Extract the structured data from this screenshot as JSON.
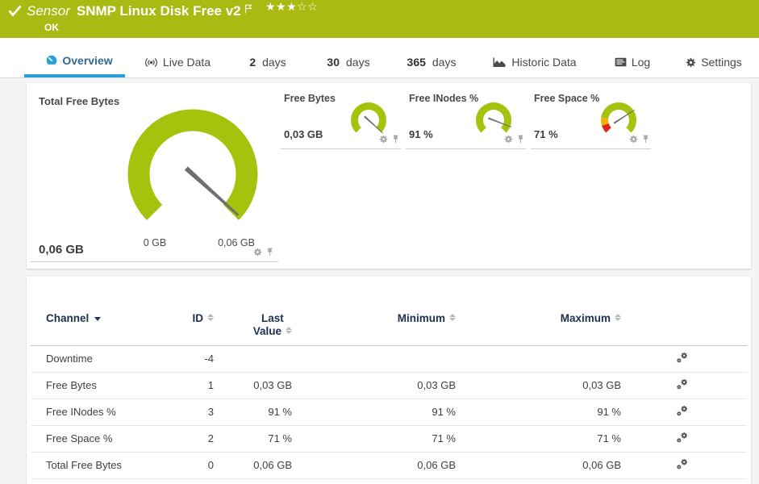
{
  "header": {
    "type_label": "Sensor",
    "title": "SNMP Linux Disk Free v2",
    "status": "OK",
    "stars": "★★★☆☆",
    "bg_color": "#a9ba12"
  },
  "tabs": [
    {
      "label": "Overview",
      "icon": "gauge",
      "active": true
    },
    {
      "label": "Live Data",
      "icon": "live-waves"
    },
    {
      "num": "2",
      "unit": "days"
    },
    {
      "num": "30",
      "unit": "days"
    },
    {
      "num": "365",
      "unit": "days"
    },
    {
      "label": "Historic Data",
      "icon": "area-chart"
    },
    {
      "label": "Log",
      "icon": "log-list"
    },
    {
      "label": "Settings",
      "icon": "gear"
    }
  ],
  "gauges": {
    "accent_green": "#a5c30d",
    "warn_orange": "#f2b600",
    "error_red": "#dc261d",
    "big": {
      "label": "Total Free Bytes",
      "value": "0,06 GB",
      "scale_min": "0 GB",
      "scale_max": "0,06 GB"
    },
    "small": [
      {
        "label": "Free Bytes",
        "value": "0,03 GB"
      },
      {
        "label": "Free INodes %",
        "value": "91 %"
      },
      {
        "label": "Free Space %",
        "value": "71 %"
      }
    ]
  },
  "table": {
    "headers": {
      "channel": "Channel",
      "id": "ID",
      "last_line1": "Last",
      "last_line2": "Value",
      "minimum": "Minimum",
      "maximum": "Maximum"
    },
    "rows": [
      {
        "channel": "Downtime",
        "id": "-4",
        "last": "",
        "min": "",
        "max": ""
      },
      {
        "channel": "Free Bytes",
        "id": "1",
        "last": "0,03 GB",
        "min": "0,03 GB",
        "max": "0,03 GB"
      },
      {
        "channel": "Free INodes %",
        "id": "3",
        "last": "91 %",
        "min": "91 %",
        "max": "91 %"
      },
      {
        "channel": "Free Space %",
        "id": "2",
        "last": "71 %",
        "min": "71 %",
        "max": "71 %"
      },
      {
        "channel": "Total Free Bytes",
        "id": "0",
        "last": "0,06 GB",
        "min": "0,06 GB",
        "max": "0,06 GB"
      }
    ]
  }
}
